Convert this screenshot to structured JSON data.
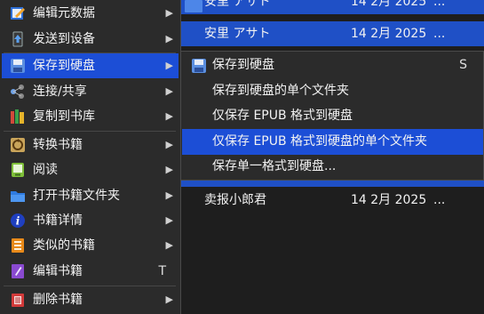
{
  "books": [
    {
      "title": "安里 アサト",
      "date": "14 2月 2025",
      "more": "..."
    },
    {
      "title": "安里 アサト",
      "date": "14 2月 2025",
      "more": "..."
    },
    {
      "title": "卖报小郎君",
      "date": "14 2月 2025",
      "more": "..."
    }
  ],
  "menu": {
    "items": [
      {
        "label": "编辑元数据",
        "icon": "edit-metadata-icon",
        "arrow": "▶"
      },
      {
        "label": "发送到设备",
        "icon": "send-to-device-icon",
        "arrow": "▶"
      },
      {
        "label": "保存到硬盘",
        "icon": "save-disk-icon",
        "arrow": "▶"
      },
      {
        "label": "连接/共享",
        "icon": "connect-share-icon",
        "arrow": "▶"
      },
      {
        "label": "复制到书库",
        "icon": "copy-library-icon",
        "arrow": "▶"
      },
      {
        "label": "转换书籍",
        "icon": "convert-book-icon",
        "arrow": "▶"
      },
      {
        "label": "阅读",
        "icon": "read-book-icon",
        "arrow": "▶"
      },
      {
        "label": "打开书籍文件夹",
        "icon": "open-folder-icon",
        "arrow": "▶"
      },
      {
        "label": "书籍详情",
        "icon": "info-icon",
        "arrow": "▶"
      },
      {
        "label": "类似的书籍",
        "icon": "similar-books-icon",
        "arrow": "▶"
      },
      {
        "label": "编辑书籍",
        "icon": "edit-book-icon",
        "shortcut": "T"
      },
      {
        "label": "删除书籍",
        "icon": "delete-book-icon",
        "arrow": "▶"
      }
    ]
  },
  "submenu": {
    "items": [
      {
        "label": "保存到硬盘",
        "icon": "save-disk-icon",
        "shortcut": "S"
      },
      {
        "label": "保存到硬盘的单个文件夹"
      },
      {
        "label": "仅保存 EPUB 格式到硬盘"
      },
      {
        "label": "仅保存 EPUB 格式到硬盘的单个文件夹"
      },
      {
        "label": "保存单一格式到硬盘..."
      }
    ]
  },
  "colors": {
    "selection": "#1c4ed6",
    "menu_bg": "#2b2b2b",
    "list_bg": "#1e1e1e"
  }
}
